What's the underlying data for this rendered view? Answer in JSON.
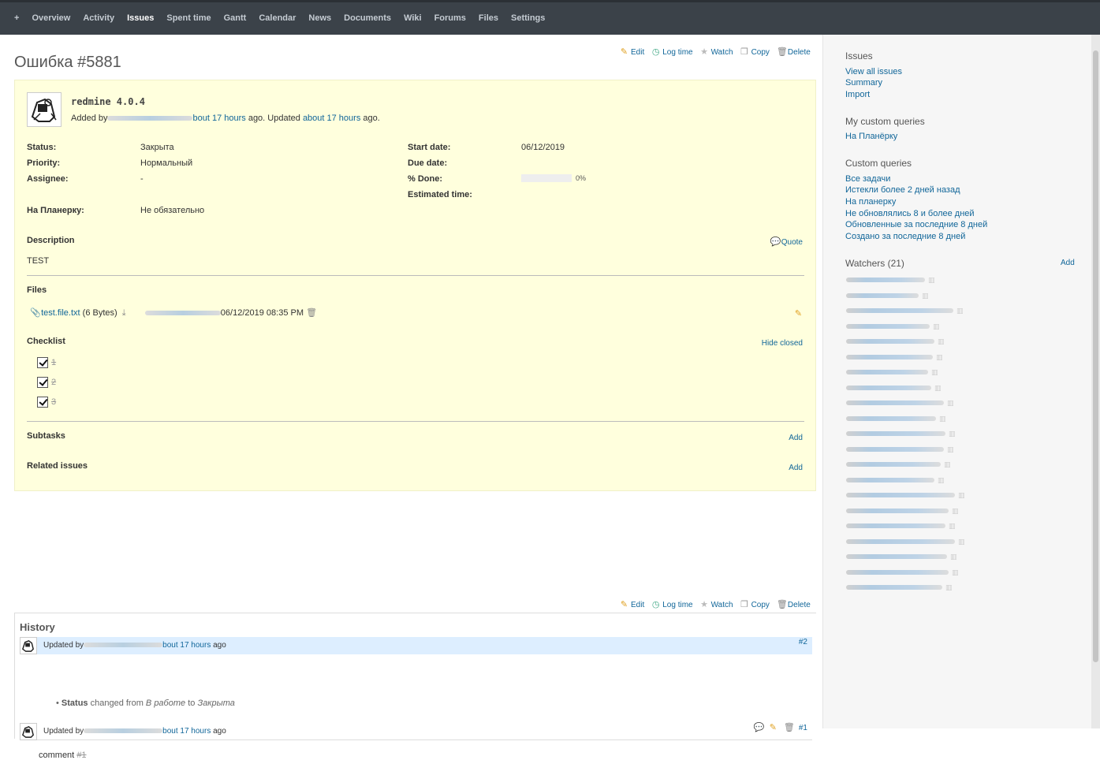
{
  "nav": {
    "tabs": [
      {
        "label": "+",
        "active": false
      },
      {
        "label": "Overview",
        "active": false
      },
      {
        "label": "Activity",
        "active": false
      },
      {
        "label": "Issues",
        "active": true
      },
      {
        "label": "Spent time",
        "active": false
      },
      {
        "label": "Gantt",
        "active": false
      },
      {
        "label": "Calendar",
        "active": false
      },
      {
        "label": "News",
        "active": false
      },
      {
        "label": "Documents",
        "active": false
      },
      {
        "label": "Wiki",
        "active": false
      },
      {
        "label": "Forums",
        "active": false
      },
      {
        "label": "Files",
        "active": false
      },
      {
        "label": "Settings",
        "active": false
      }
    ]
  },
  "actions": {
    "edit": "Edit",
    "log_time": "Log time",
    "watch": "Watch",
    "copy": "Copy",
    "delete": "Delete"
  },
  "issue": {
    "title": "Ошибка #5881",
    "subject": "redmine 4.0.4",
    "added_by_prefix": "Added by",
    "added_time": "bout 17 hours",
    "updated_mid": " ago. Updated ",
    "updated_time": "about 17 hours",
    "updated_suffix": " ago.",
    "attributes_left": [
      {
        "label": "Status:",
        "value": "Закрыта"
      },
      {
        "label": "Priority:",
        "value": "Нормальный"
      },
      {
        "label": "Assignee:",
        "value": "-"
      },
      {
        "label": "На Планерку:",
        "value": "Не обязательно"
      }
    ],
    "attributes_right": [
      {
        "label": "Start date:",
        "value": "06/12/2019"
      },
      {
        "label": "Due date:",
        "value": ""
      },
      {
        "label": "% Done:",
        "value": "0%"
      },
      {
        "label": "Estimated time:",
        "value": ""
      }
    ],
    "done_ratio": 0,
    "description_title": "Description",
    "description": "TEST",
    "quote": "Quote",
    "files_title": "Files",
    "file": {
      "name": "test.file.txt",
      "size": "(6 Bytes)",
      "date": "06/12/2019 08:35 PM"
    },
    "checklist_title": "Checklist",
    "hide_closed": "Hide closed",
    "checklist": [
      "1",
      "2",
      "3"
    ],
    "subtasks_title": "Subtasks",
    "related_title": "Related issues",
    "add": "Add"
  },
  "history": {
    "title": "History",
    "journals": [
      {
        "prefix": "Updated by",
        "time": "bout 17 hours",
        "suffix": " ago",
        "num": "#2",
        "detail_field": "Status",
        "detail_mid1": " changed from ",
        "detail_old": "В работе",
        "detail_mid2": " to ",
        "detail_new": "Закрыта"
      },
      {
        "prefix": "Updated by",
        "time": "bout 17 hours",
        "suffix": " ago",
        "num": "#1",
        "comment": "comment",
        "comment_ref": "#1"
      }
    ]
  },
  "sidebar": {
    "issues_title": "Issues",
    "issues_links": [
      "View all issues",
      "Summary",
      "Import"
    ],
    "my_queries_title": "My custom queries",
    "my_queries": [
      "На Планёрку"
    ],
    "custom_queries_title": "Custom queries",
    "custom_queries": [
      "Все задачи",
      "Истекли более 2 дней назад",
      "На планерку",
      "Не обновлялись 8 и более дней",
      "Обновленные за последние 8 дней",
      "Создано за последние 8 дней"
    ],
    "watchers_title": "Watchers (21)",
    "watchers_add": "Add",
    "watcher_count": 21
  },
  "colors": {
    "nav_bg": "#3b4249",
    "issue_bg": "#ffffdd",
    "link": "#1166aa",
    "sidebar_bg": "#f6f6f6",
    "journal_highlight": "#ddeeff"
  }
}
